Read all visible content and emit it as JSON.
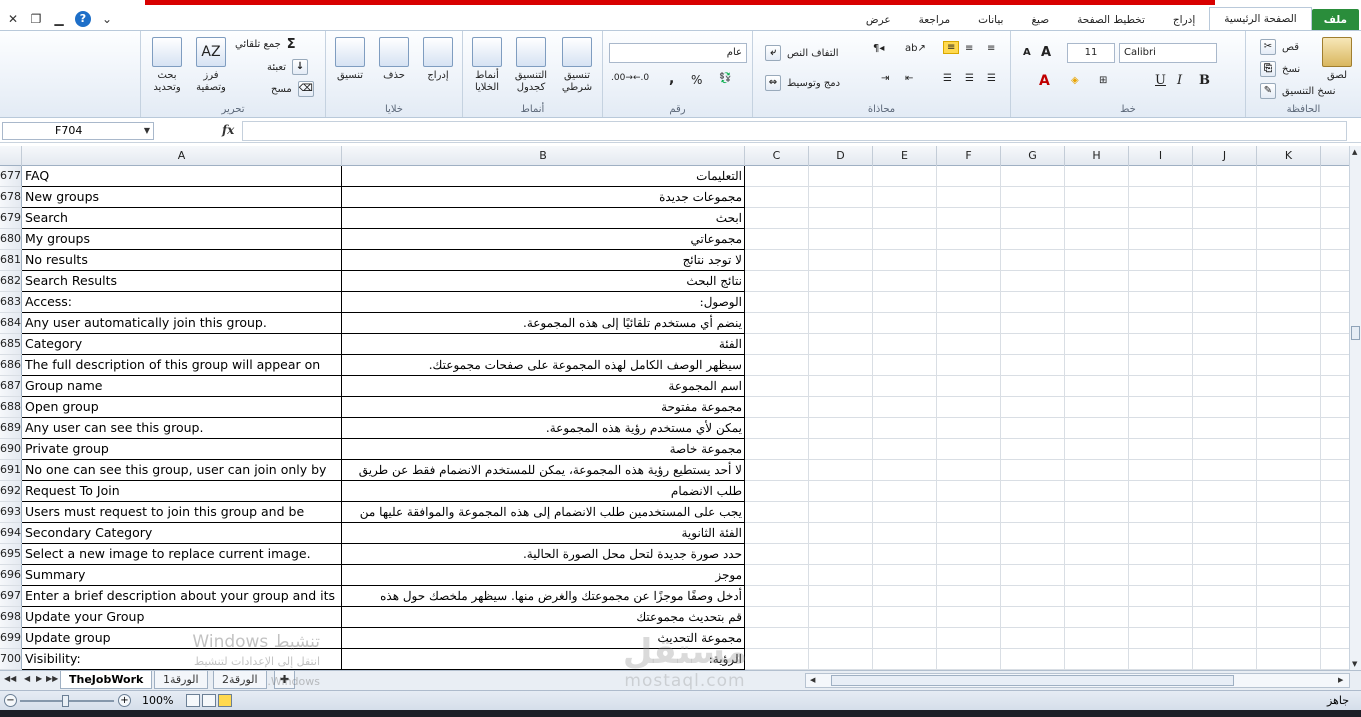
{
  "qat": {
    "icons": [
      "close-icon",
      "restore-icon",
      "minimize-icon",
      "help-icon",
      "collapse-ribbon-icon"
    ]
  },
  "tabs": [
    "ملف",
    "الصفحة الرئيسية",
    "إدراج",
    "تخطيط الصفحة",
    "صيغ",
    "بيانات",
    "مراجعة",
    "عرض"
  ],
  "ribbon": {
    "clipboard": {
      "label": "الحافظة",
      "paste": "لصق",
      "cut": "قص",
      "copy": "نسخ",
      "format_painter": "نسخ التنسيق"
    },
    "font": {
      "label": "خط",
      "name": "Calibri",
      "size": "11",
      "bold": "B",
      "italic": "I",
      "underline": "U",
      "grow": "A",
      "shrink": "A"
    },
    "alignment": {
      "label": "محاذاة",
      "wrap": "التفاف النص",
      "merge": "دمج وتوسيط"
    },
    "number": {
      "label": "رقم",
      "format": "عام",
      "percent": "%",
      "comma": ","
    },
    "styles": {
      "label": "أنماط",
      "conditional": "تنسيق\nشرطي",
      "table": "التنسيق\nكجدول",
      "cell": "أنماط\nالخلايا"
    },
    "cells": {
      "label": "خلايا",
      "insert": "إدراج",
      "delete": "حذف",
      "format": "تنسيق"
    },
    "editing": {
      "label": "تحرير",
      "autosum": "جمع تلقائي",
      "fill": "تعبئة",
      "clear": "مسح",
      "sort": "فرز\nوتصفية",
      "find": "بحث\nوتحديد"
    }
  },
  "formula_bar": {
    "name_box": "F704",
    "fx": "fx",
    "content": ""
  },
  "columns": [
    "A",
    "B",
    "C",
    "D",
    "E",
    "F",
    "G",
    "H",
    "I",
    "J",
    "K"
  ],
  "rows": [
    {
      "n": "677",
      "a": "FAQ",
      "b": "التعليمات"
    },
    {
      "n": "678",
      "a": "New groups",
      "b": "مجموعات جديدة"
    },
    {
      "n": "679",
      "a": "Search",
      "b": "ابحث"
    },
    {
      "n": "680",
      "a": "My groups",
      "b": "مجموعاتي"
    },
    {
      "n": "681",
      "a": "No results",
      "b": "لا توجد نتائج"
    },
    {
      "n": "682",
      "a": "Search Results",
      "b": "نتائج البحث"
    },
    {
      "n": "683",
      "a": "Access:",
      "b": "الوصول:"
    },
    {
      "n": "684",
      "a": "Any user automatically join this group.",
      "b": "ينضم أي مستخدم تلقائيًا إلى هذه المجموعة."
    },
    {
      "n": "685",
      "a": "Category",
      "b": "الفئة"
    },
    {
      "n": "686",
      "a": "The full description of this group will appear on",
      "b": "سيظهر الوصف الكامل لهذه المجموعة على صفحات مجموعتك."
    },
    {
      "n": "687",
      "a": "Group name",
      "b": "اسم المجموعة"
    },
    {
      "n": "688",
      "a": "Open group",
      "b": "مجموعة مفتوحة"
    },
    {
      "n": "689",
      "a": "Any user can see this group.",
      "b": "يمكن لأي مستخدم رؤية هذه المجموعة."
    },
    {
      "n": "690",
      "a": "Private group",
      "b": "مجموعة خاصة"
    },
    {
      "n": "691",
      "a": "No one can see this group, user can join only by",
      "b": "لا أحد يستطيع رؤية هذه المجموعة، يمكن للمستخدم الانضمام فقط عن طريق"
    },
    {
      "n": "692",
      "a": "Request To Join",
      "b": "طلب الانضمام"
    },
    {
      "n": "693",
      "a": "Users must request to join this group and be",
      "b": "يجب على المستخدمين طلب الانضمام إلى هذه المجموعة والموافقة عليها من"
    },
    {
      "n": "694",
      "a": "Secondary Category",
      "b": "الفئة الثانوية"
    },
    {
      "n": "695",
      "a": "Select a new image to replace current image.",
      "b": "حدد صورة جديدة لتحل محل الصورة الحالية."
    },
    {
      "n": "696",
      "a": "Summary",
      "b": "موجز"
    },
    {
      "n": "697",
      "a": "Enter a brief description about your group and its",
      "b": "أدخل وصفًا موجزًا عن مجموعتك والغرض منها. سيظهر ملخصك حول هذه"
    },
    {
      "n": "698",
      "a": "Update your Group",
      "b": "قم بتحديث مجموعتك"
    },
    {
      "n": "699",
      "a": "Update group",
      "b": "مجموعة التحديث"
    },
    {
      "n": "700",
      "a": "Visibility:",
      "b": "الرؤية:"
    }
  ],
  "sheets": [
    {
      "name": "TheJobWork",
      "active": true
    },
    {
      "name": "الورقة1",
      "active": false
    },
    {
      "name": "الورقة2",
      "active": false
    }
  ],
  "status": {
    "zoom": "100%",
    "ready": "جاهز",
    "minus": "−",
    "plus": "+"
  },
  "watermark": {
    "line1": "تنشيط Windows",
    "line2": "انتقل إلى الإعدادات لتنشيط Windows."
  },
  "logo": {
    "ar": "مستقل",
    "en": "mostaql.com"
  }
}
